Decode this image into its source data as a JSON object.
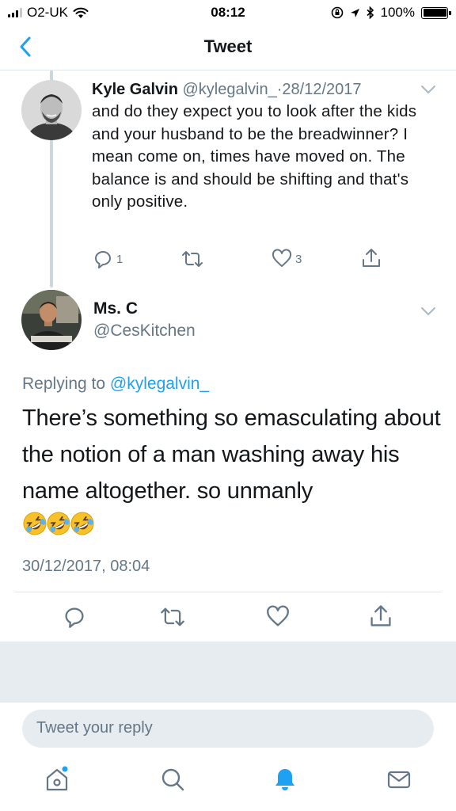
{
  "status_bar": {
    "carrier": "O2-UK",
    "time": "08:12",
    "battery": "100%"
  },
  "nav": {
    "title": "Tweet"
  },
  "parent_tweet": {
    "author_name": "Kyle Galvin",
    "author_handle": "@kylegalvin_",
    "separator": "·",
    "date": "28/12/2017",
    "text": "and do they expect you to look after the kids and your husband to be the breadwinner? I mean come on, times have moved on. The balance is and should be shifting and that's only positive.",
    "reply_count": "1",
    "like_count": "3"
  },
  "main_tweet": {
    "author_name": "Ms. C",
    "author_handle": "@CesKitchen",
    "replying_prefix": "Replying to",
    "replying_to": "@kylegalvin_",
    "text": "There’s something so emasculating about the notion of a man washing away his name altogether. so unmanly",
    "emojis": [
      "rolling-on-floor-laughing",
      "rolling-on-floor-laughing",
      "rolling-on-floor-laughing"
    ],
    "timestamp": "30/12/2017, 08:04"
  },
  "composer": {
    "placeholder": "Tweet your reply"
  },
  "tabbar": {
    "items": [
      "home-icon",
      "search-icon",
      "notifications-icon",
      "messages-icon"
    ],
    "active": "notifications-icon"
  },
  "colors": {
    "accent": "#1da1f2",
    "secondary_text": "#657786",
    "divider": "#e1e8ed",
    "background_gray": "#e6ecf0"
  }
}
